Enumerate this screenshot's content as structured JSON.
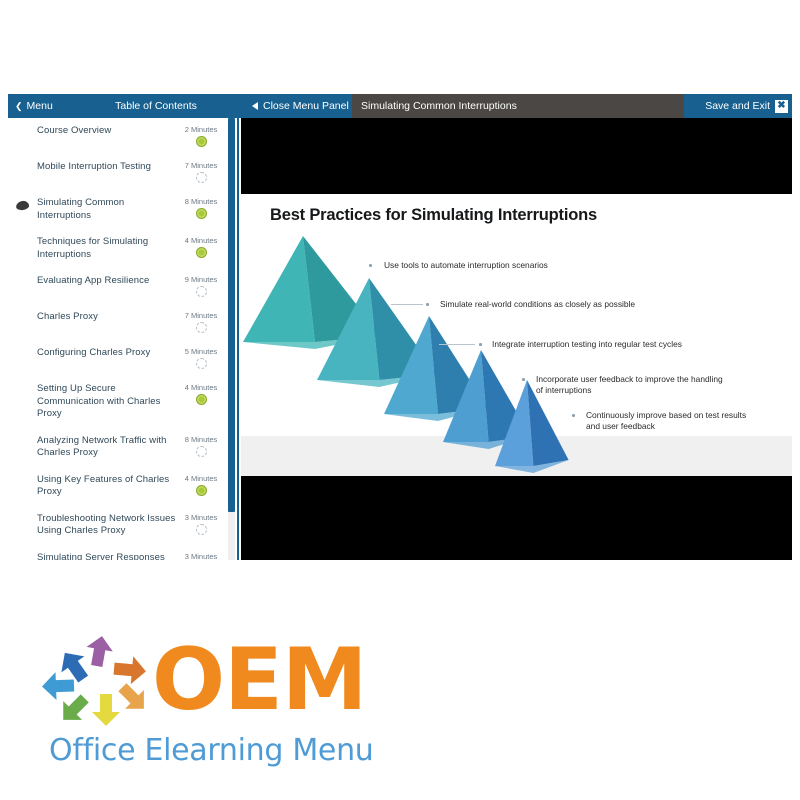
{
  "player": {
    "topbar": {
      "menu_label": "Menu",
      "menu_chevron_icon": "chevron-left-icon",
      "toc_title": "Table of Contents",
      "close_menu_panel_label": "Close Menu Panel",
      "close_panel_icon": "triangle-left-icon",
      "current_slide_title": "Simulating Common Interruptions",
      "save_and_exit_label": "Save and Exit",
      "close_icon_glyph": "✖"
    },
    "toc_items": [
      {
        "label": "Course Overview",
        "duration": "2 Minutes",
        "status": "done",
        "current": false
      },
      {
        "label": "Mobile Interruption Testing",
        "duration": "7 Minutes",
        "status": "todo",
        "current": false
      },
      {
        "label": "Simulating Common Interruptions",
        "duration": "8 Minutes",
        "status": "done",
        "current": true
      },
      {
        "label": "Techniques for Simulating Interruptions",
        "duration": "4 Minutes",
        "status": "done",
        "current": false
      },
      {
        "label": "Evaluating App Resilience",
        "duration": "9 Minutes",
        "status": "todo",
        "current": false
      },
      {
        "label": "Charles Proxy",
        "duration": "7 Minutes",
        "status": "todo",
        "current": false
      },
      {
        "label": "Configuring Charles Proxy",
        "duration": "5 Minutes",
        "status": "todo",
        "current": false
      },
      {
        "label": "Setting Up Secure Communication with Charles Proxy",
        "duration": "4 Minutes",
        "status": "done",
        "current": false
      },
      {
        "label": "Analyzing Network Traffic with Charles Proxy",
        "duration": "8 Minutes",
        "status": "todo",
        "current": false
      },
      {
        "label": "Using Key Features of Charles Proxy",
        "duration": "4 Minutes",
        "status": "done",
        "current": false
      },
      {
        "label": "Troubleshooting Network Issues Using Charles Proxy",
        "duration": "3 Minutes",
        "status": "todo",
        "current": false
      },
      {
        "label": "Simulating Server Responses with Charles Proxy",
        "duration": "3 Minutes",
        "status": "done",
        "current": false
      }
    ],
    "slide": {
      "title": "Best Practices for Simulating Interruptions",
      "bullets": [
        {
          "text": "Use tools to automate interruption scenarios"
        },
        {
          "text": "Simulate real-world conditions as closely as possible"
        },
        {
          "text": "Integrate interruption testing into regular test cycles"
        },
        {
          "text": "Incorporate user feedback to improve the handling of interruptions"
        },
        {
          "text": "Continuously improve based on test results and user feedback"
        }
      ],
      "pyramid_colors": [
        {
          "light": "#3fb5b5",
          "dark": "#2e9a9e"
        },
        {
          "light": "#48b4bf",
          "dark": "#2f8fa8"
        },
        {
          "light": "#4fa8cf",
          "dark": "#2f7fae"
        },
        {
          "light": "#4e9ed2",
          "dark": "#2d77b2"
        },
        {
          "light": "#5ba0da",
          "dark": "#2f72b4"
        }
      ]
    }
  },
  "logo": {
    "wordmark": "OEM",
    "tagline": "Office Elearning Menu",
    "wordmark_color": "#f18a1e",
    "tagline_color": "#4f9bd5",
    "arrow_colors": [
      "#2b6cb5",
      "#9b5fa3",
      "#d9762e",
      "#e8a44a",
      "#e4d93f",
      "#6aab4a",
      "#3f9bd4",
      "#4f9bd5"
    ]
  },
  "theme": {
    "header_blue": "#17608f",
    "title_bar_gray": "#4a4744",
    "status_done_green": "#a9c93a",
    "letterbox_black": "#000000"
  }
}
